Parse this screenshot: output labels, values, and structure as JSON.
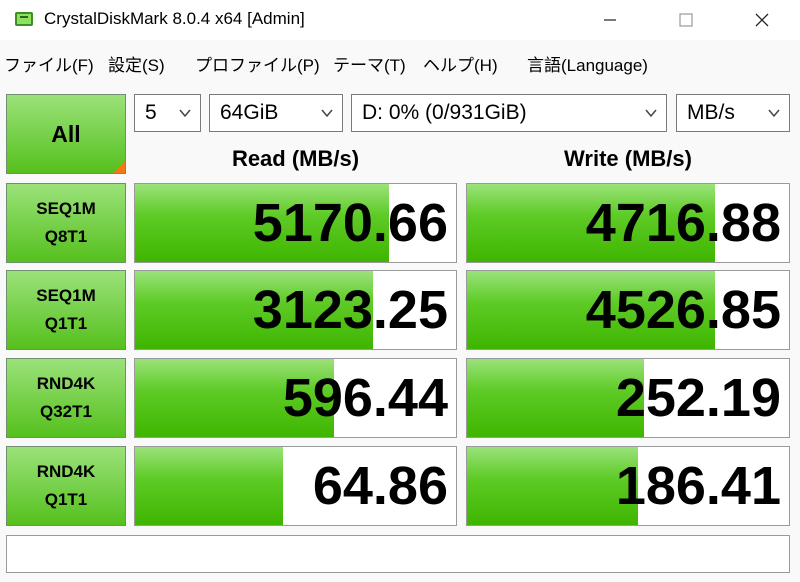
{
  "window": {
    "title": "CrystalDiskMark 8.0.4 x64 [Admin]",
    "controls": [
      "minimize",
      "maximize",
      "close"
    ]
  },
  "menu": [
    "ファイル(F)",
    "設定(S)",
    "プロファイル(P)",
    "テーマ(T)",
    "ヘルプ(H)",
    "言語(Language)"
  ],
  "controls": {
    "all_label": "All",
    "count": "5",
    "size": "64GiB",
    "drive": "D: 0% (0/931GiB)",
    "unit": "MB/s"
  },
  "headers": {
    "read": "Read (MB/s)",
    "write": "Write (MB/s)"
  },
  "tests": [
    {
      "line1": "SEQ1M",
      "line2": "Q8T1",
      "read": "5170.66",
      "write": "4716.88",
      "read_fill": 0.79,
      "write_fill": 0.77
    },
    {
      "line1": "SEQ1M",
      "line2": "Q1T1",
      "read": "3123.25",
      "write": "4526.85",
      "read_fill": 0.74,
      "write_fill": 0.77
    },
    {
      "line1": "RND4K",
      "line2": "Q32T1",
      "read": "596.44",
      "write": "252.19",
      "read_fill": 0.62,
      "write_fill": 0.55
    },
    {
      "line1": "RND4K",
      "line2": "Q1T1",
      "read": "64.86",
      "write": "186.41",
      "read_fill": 0.46,
      "write_fill": 0.53
    }
  ],
  "colors": {
    "accent_green": "#55c01d",
    "corner_orange": "#f07b16"
  },
  "status_text": ""
}
